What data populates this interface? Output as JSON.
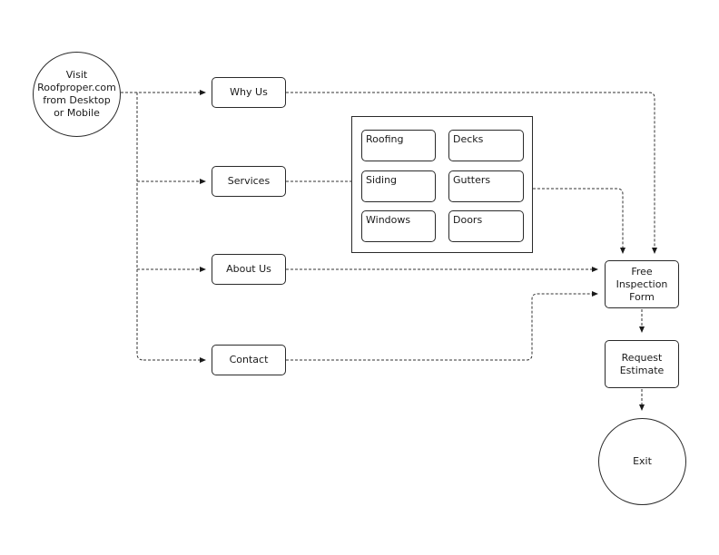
{
  "nodes": {
    "start": "Visit Roofproper.com from Desktop or Mobile",
    "why_us": "Why Us",
    "services": "Services",
    "about_us": "About Us",
    "contact": "Contact",
    "free_inspection": "Free Inspection Form",
    "request_estimate": "Request Estimate",
    "exit": "Exit"
  },
  "services_group": {
    "items": [
      "Roofing",
      "Decks",
      "Siding",
      "Gutters",
      "Windows",
      "Doors"
    ]
  },
  "edges": [
    {
      "from": "start",
      "to": "why_us",
      "style": "dashed"
    },
    {
      "from": "start",
      "to": "services",
      "style": "dashed"
    },
    {
      "from": "start",
      "to": "about_us",
      "style": "dashed"
    },
    {
      "from": "start",
      "to": "contact",
      "style": "dashed"
    },
    {
      "from": "why_us",
      "to": "free_inspection",
      "style": "dashed"
    },
    {
      "from": "services",
      "to": "services_group",
      "style": "dashed"
    },
    {
      "from": "services_group",
      "to": "free_inspection",
      "style": "dashed"
    },
    {
      "from": "about_us",
      "to": "free_inspection",
      "style": "dashed"
    },
    {
      "from": "contact",
      "to": "free_inspection",
      "style": "dashed"
    },
    {
      "from": "free_inspection",
      "to": "request_estimate",
      "style": "dashed"
    },
    {
      "from": "request_estimate",
      "to": "exit",
      "style": "dashed"
    }
  ]
}
